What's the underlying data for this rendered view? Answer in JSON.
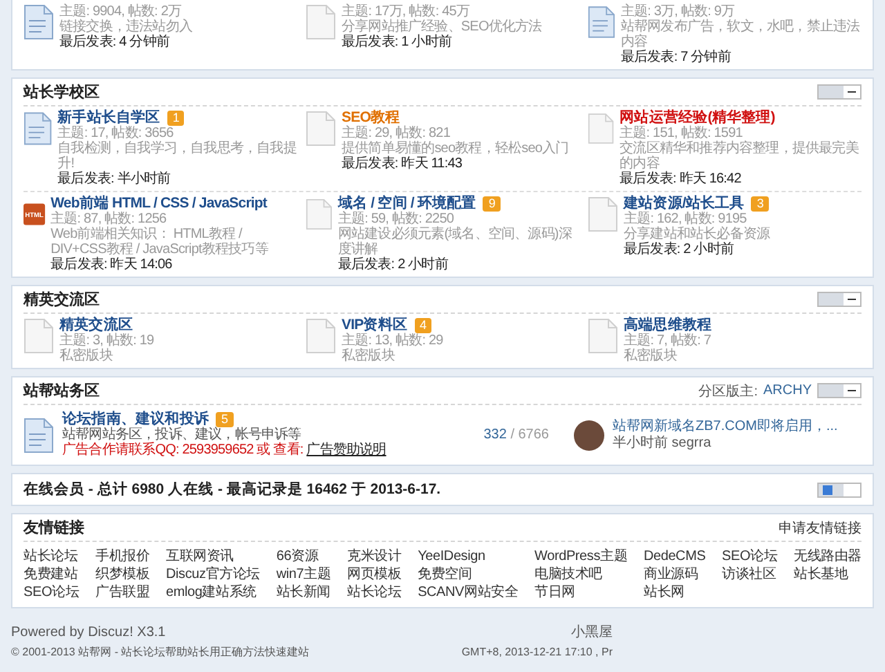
{
  "top_section": {
    "forums": [
      {
        "kind": "new",
        "stats": "主题: 9904, 帖数: 2万",
        "description": "链接交换，违法站勿入",
        "last_post": "最后发表: 4 分钟前"
      },
      {
        "kind": "plain",
        "stats": "主题: 17万, 帖数: 45万",
        "description": "分享网站推广经验、SEO优化方法",
        "last_post": "最后发表: 1 小时前"
      },
      {
        "kind": "new",
        "stats": "主题: 3万, 帖数: 9万",
        "description": "站帮网发布广告，软文，水吧，禁止违法内容",
        "last_post": "最后发表: 7 分钟前"
      }
    ]
  },
  "sections": [
    {
      "title": "站长学校区",
      "expanded": true,
      "rows": [
        [
          {
            "kind": "new",
            "title": "新手站长自学区",
            "color": "#1f4e8c",
            "badge": "1",
            "stats": "主题: 17, 帖数: 3656",
            "description": "自我检测，自我学习，自我思考，自我提升!",
            "last_post": "最后发表: 半小时前"
          },
          {
            "kind": "plain",
            "title": "SEO教程",
            "color": "#e07000",
            "stats": "主题: 29, 帖数: 821",
            "description": "提供简单易懂的seo教程，轻松seo入门",
            "last_post": "最后发表: 昨天 11:43"
          },
          {
            "kind": "plain",
            "title": "网站运营经验(精华整理)",
            "color": "#d01010",
            "stats": "主题: 151, 帖数: 1591",
            "description": "交流区精华和推荐内容整理，提供最完美的内容",
            "last_post": "最后发表: 昨天 16:42"
          }
        ],
        [
          {
            "kind": "logo",
            "logo_text": "HTML",
            "title": "Web前端 HTML / CSS / JavaScript",
            "color": "#1f4e8c",
            "stats": "主题: 87, 帖数: 1256",
            "description": "Web前端相关知识： HTML教程 / DIV+CSS教程 / JavaScript教程技巧等",
            "last_post": "最后发表: 昨天 14:06"
          },
          {
            "kind": "plain",
            "title": "域名 / 空间 / 环境配置",
            "color": "#1f4e8c",
            "badge": "9",
            "stats": "主题: 59, 帖数: 2250",
            "description": "网站建设必须元素(域名、空间、源码)深度讲解",
            "last_post": "最后发表: 2 小时前"
          },
          {
            "kind": "plain",
            "title": "建站资源/站长工具",
            "color": "#1f4e8c",
            "badge": "3",
            "stats": "主题: 162, 帖数: 9195",
            "description": "分享建站和站长必备资源",
            "last_post": "最后发表: 2 小时前"
          }
        ]
      ]
    },
    {
      "title": "精英交流区",
      "expanded": true,
      "rows": [
        [
          {
            "kind": "plain",
            "title": "精英交流区",
            "color": "#1f4e8c",
            "stats": "主题: 3, 帖数: 19",
            "description": "私密版块"
          },
          {
            "kind": "plain",
            "title": "VIP资料区",
            "color": "#1f4e8c",
            "badge": "4",
            "stats": "主题: 13, 帖数: 29",
            "description": "私密版块"
          },
          {
            "kind": "plain",
            "title": "高端思维教程",
            "color": "#1f4e8c",
            "stats": "主题: 7, 帖数: 7",
            "description": "私密版块"
          }
        ]
      ]
    }
  ],
  "service_section": {
    "title": "站帮站务区",
    "expanded": true,
    "moderator_label": "分区版主:",
    "moderator": "ARCHY",
    "forum": {
      "title": "论坛指南、建议和投诉",
      "badge": "5",
      "description": "站帮网站务区，投诉、建议，帐号申诉等",
      "ad_text": "广告合作请联系QQ: 2593959652 或 查看:",
      "ad_link": "广告赞助说明",
      "threads": "332",
      "posts": "/ 6766",
      "last_title": "站帮网新域名ZB7.COM即将启用，...",
      "last_time": "半小时前",
      "last_user": "segrra"
    }
  },
  "online": {
    "text": "在线会员 - 总计 6980 人在线 - 最高记录是 16462 于 2013-6-17.",
    "expanded": false
  },
  "links": {
    "title": "友情链接",
    "apply": "申请友情链接",
    "items": [
      "站长论坛",
      "手机报价",
      "互联网资讯",
      "66资源",
      "克米设计",
      "YeeIDesign",
      "WordPress主题",
      "DedeCMS",
      "SEO论坛",
      "无线路由器",
      "免费建站",
      "织梦模板",
      "Discuz官方论坛",
      "win7主题",
      "网页模板",
      "免费空间",
      "电脑技术吧",
      "商业源码",
      "访谈社区",
      "站长基地",
      "SEO论坛",
      "广告联盟",
      "emlog建站系统",
      "站长新闻",
      "站长论坛",
      "SCANV网站安全",
      "节日网",
      "站长网"
    ]
  },
  "footer": {
    "powered": "Powered by Discuz! X3.1",
    "copyright": "© 2001-2013 站帮网 - 站长论坛帮助站长用正确方法快速建站",
    "blackroom": "小黑屋",
    "time": "GMT+8, 2013-12-21 17:10 , Pr"
  }
}
